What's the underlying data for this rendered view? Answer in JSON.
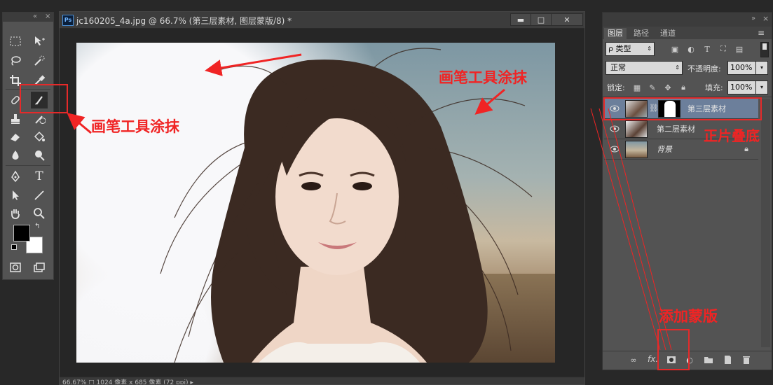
{
  "document": {
    "title": "jc160205_4a.jpg @ 66.7% (第三层素材, 图层蒙版/8) *",
    "status": "66.67%  □  1024 像素 x 685 像素 (72 ppi)  ▸"
  },
  "layers_panel": {
    "tabs": [
      "图层",
      "路径",
      "通道"
    ],
    "filter_label": "ρ 类型",
    "blend_mode": "正常",
    "opacity_label": "不透明度:",
    "opacity_value": "100%",
    "lock_label": "锁定:",
    "fill_label": "填充:",
    "fill_value": "100%",
    "layers": [
      {
        "name": "第三层素材",
        "selected": true,
        "has_mask": true
      },
      {
        "name": "第二层素材",
        "selected": false,
        "has_mask": false
      },
      {
        "name": "背景",
        "selected": false,
        "locked": true
      }
    ],
    "bottom_icons": [
      "link-icon",
      "fx-icon",
      "add-mask-icon",
      "adjustment-icon",
      "folder-icon",
      "new-layer-icon",
      "trash-icon"
    ],
    "fx_label": "fx."
  },
  "annotations": {
    "brush_tool_left": "画笔工具涂抹",
    "brush_tool_top": "画笔工具涂抹",
    "normal_overlay": "正片叠底",
    "add_mask": "添加蒙版",
    "color": "#f02424"
  },
  "colors": {
    "panel_bg": "#535353",
    "selected_layer": "#6c7f9b",
    "workspace": "#282828"
  }
}
